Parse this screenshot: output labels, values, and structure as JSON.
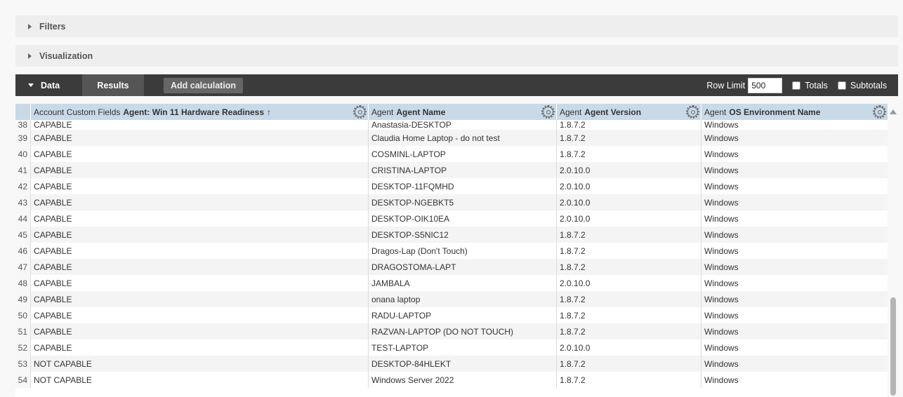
{
  "sections": {
    "filters": "Filters",
    "visualization": "Visualization"
  },
  "data_bar": {
    "data_tab": "Data",
    "results_tab": "Results",
    "add_calculation": "Add calculation",
    "row_limit_label": "Row Limit",
    "row_limit_value": "500",
    "totals_label": "Totals",
    "subtotals_label": "Subtotals"
  },
  "columns": [
    {
      "prefix": "Account Custom Fields",
      "name": "Agent: Win 11 Hardware Readiness",
      "sort": "↑"
    },
    {
      "prefix": "Agent",
      "name": "Agent Name",
      "sort": ""
    },
    {
      "prefix": "Agent",
      "name": "Agent Version",
      "sort": ""
    },
    {
      "prefix": "Agent",
      "name": "OS Environment Name",
      "sort": ""
    }
  ],
  "rows": [
    {
      "n": "38",
      "readiness": "CAPABLE",
      "name": "Anastasia-DESKTOP",
      "version": "1.8.7.2",
      "os": "Windows"
    },
    {
      "n": "39",
      "readiness": "CAPABLE",
      "name": "Claudia Home Laptop - do not test",
      "version": "1.8.7.2",
      "os": "Windows"
    },
    {
      "n": "40",
      "readiness": "CAPABLE",
      "name": "COSMINL-LAPTOP",
      "version": "1.8.7.2",
      "os": "Windows"
    },
    {
      "n": "41",
      "readiness": "CAPABLE",
      "name": "CRISTINA-LAPTOP",
      "version": "2.0.10.0",
      "os": "Windows"
    },
    {
      "n": "42",
      "readiness": "CAPABLE",
      "name": "DESKTOP-11FQMHD",
      "version": "2.0.10.0",
      "os": "Windows"
    },
    {
      "n": "43",
      "readiness": "CAPABLE",
      "name": "DESKTOP-NGEBKT5",
      "version": "2.0.10.0",
      "os": "Windows"
    },
    {
      "n": "44",
      "readiness": "CAPABLE",
      "name": "DESKTOP-OIK10EA",
      "version": "2.0.10.0",
      "os": "Windows"
    },
    {
      "n": "45",
      "readiness": "CAPABLE",
      "name": "DESKTOP-S5NIC12",
      "version": "1.8.7.2",
      "os": "Windows"
    },
    {
      "n": "46",
      "readiness": "CAPABLE",
      "name": "Dragos-Lap (Don't Touch)",
      "version": "1.8.7.2",
      "os": "Windows"
    },
    {
      "n": "47",
      "readiness": "CAPABLE",
      "name": "DRAGOSTOMA-LAPT",
      "version": "1.8.7.2",
      "os": "Windows"
    },
    {
      "n": "48",
      "readiness": "CAPABLE",
      "name": "JAMBALA",
      "version": "2.0.10.0",
      "os": "Windows"
    },
    {
      "n": "49",
      "readiness": "CAPABLE",
      "name": "onana laptop",
      "version": "1.8.7.2",
      "os": "Windows"
    },
    {
      "n": "50",
      "readiness": "CAPABLE",
      "name": "RADU-LAPTOP",
      "version": "1.8.7.2",
      "os": "Windows"
    },
    {
      "n": "51",
      "readiness": "CAPABLE",
      "name": "RAZVAN-LAPTOP (DO NOT TOUCH)",
      "version": "1.8.7.2",
      "os": "Windows"
    },
    {
      "n": "52",
      "readiness": "CAPABLE",
      "name": "TEST-LAPTOP",
      "version": "2.0.10.0",
      "os": "Windows"
    },
    {
      "n": "53",
      "readiness": "NOT CAPABLE",
      "name": "DESKTOP-84HLEKT",
      "version": "1.8.7.2",
      "os": "Windows"
    },
    {
      "n": "54",
      "readiness": "NOT CAPABLE",
      "name": "Windows Server 2022",
      "version": "1.8.7.2",
      "os": "Windows"
    }
  ]
}
